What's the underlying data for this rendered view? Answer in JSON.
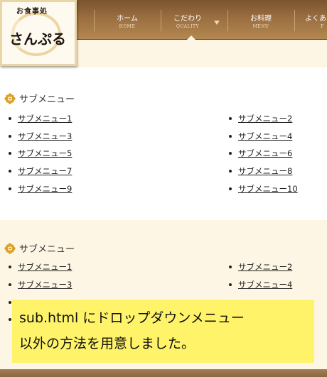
{
  "header": {
    "logo_small": "お食事処",
    "logo_big": "さんぷる",
    "nav": [
      {
        "jp": "ホーム",
        "en": "HOME"
      },
      {
        "jp": "こだわり",
        "en": "QUALITY"
      },
      {
        "jp": "お料理",
        "en": "MENU"
      },
      {
        "jp": "よくあ",
        "en": "F"
      }
    ]
  },
  "section1": {
    "title": "サブメニュー",
    "items": [
      "サブメニュー1",
      "サブメニュー2",
      "サブメニュー3",
      "サブメニュー4",
      "サブメニュー5",
      "サブメニュー6",
      "サブメニュー7",
      "サブメニュー8",
      "サブメニュー9",
      "サブメニュー10"
    ]
  },
  "section2": {
    "title": "サブメニュー",
    "items": [
      "サブメニュー1",
      "サブメニュー2",
      "サブメニュー3",
      "サブメニュー4"
    ]
  },
  "note": {
    "line1": "sub.html にドロップダウンメニュー",
    "line2": "以外の方法を用意しました。"
  },
  "colors": {
    "nav_bg": "#9a6e40",
    "page_cream": "#fdf6e4",
    "note_bg": "#fff36a",
    "icon_gold": "#e0a020"
  }
}
